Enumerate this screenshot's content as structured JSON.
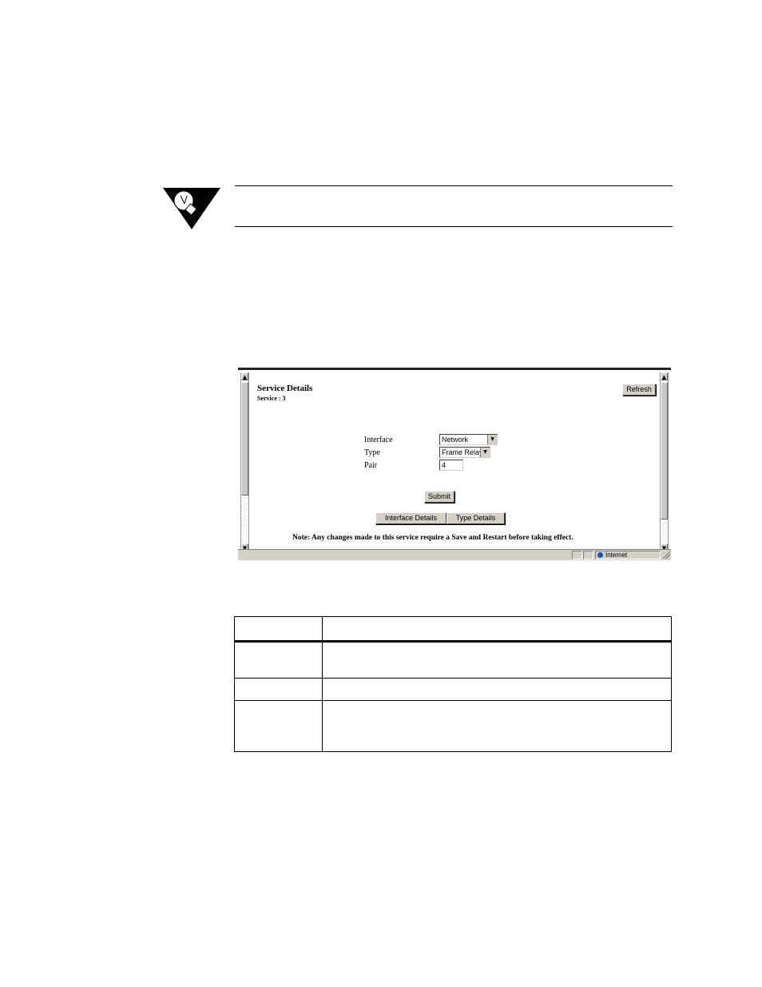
{
  "tip": {
    "icon": "lightbulb-tip-icon",
    "text": ""
  },
  "screenshot": {
    "title": "Service Details",
    "subtitle": "Service : 3",
    "refresh_label": "Refresh",
    "fields": {
      "interface_label": "Interface",
      "interface_value": "Network",
      "type_label": "Type",
      "type_value": "Frame Relay",
      "pair_label": "Pair",
      "pair_value": "4"
    },
    "submit_label": "Submit",
    "interface_details_label": "Interface Details",
    "type_details_label": "Type Details",
    "note": "Note:  Any changes made to this service require a Save and Restart before taking effect.",
    "status_zone": "Internet"
  },
  "table": {
    "rows": [
      [
        "",
        ""
      ],
      [
        "",
        ""
      ],
      [
        "",
        ""
      ],
      [
        "",
        ""
      ]
    ]
  }
}
